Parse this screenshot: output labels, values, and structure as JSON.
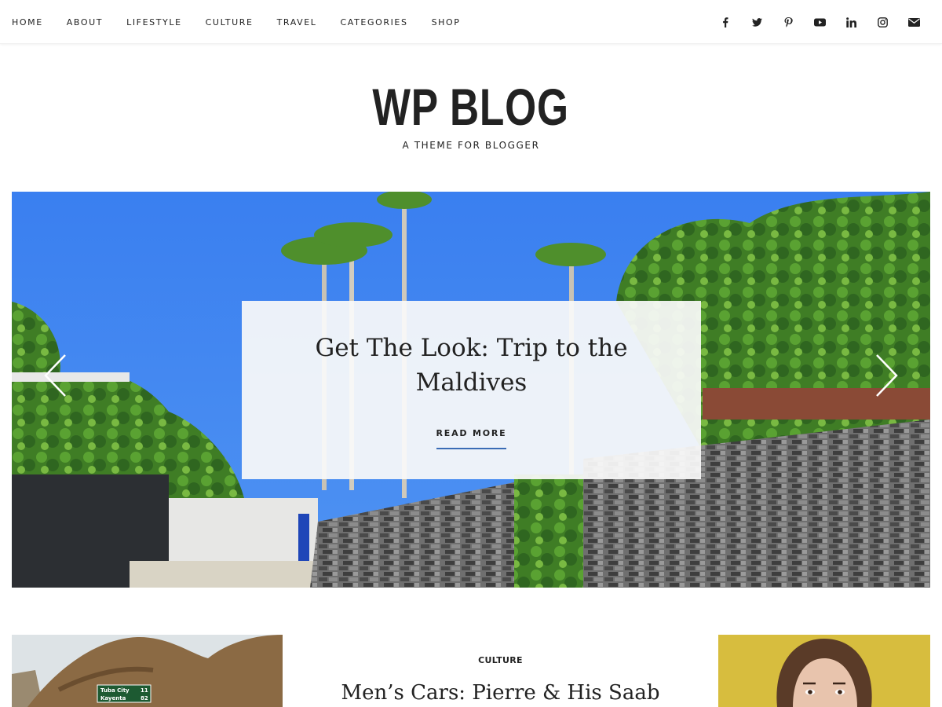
{
  "nav": {
    "items": [
      {
        "label": "HOME"
      },
      {
        "label": "ABOUT"
      },
      {
        "label": "LIFESTYLE"
      },
      {
        "label": "CULTURE"
      },
      {
        "label": "TRAVEL"
      },
      {
        "label": "CATEGORIES"
      },
      {
        "label": "SHOP"
      }
    ]
  },
  "social": {
    "icons": [
      "facebook-icon",
      "twitter-icon",
      "pinterest-icon",
      "youtube-icon",
      "linkedin-icon",
      "instagram-icon",
      "email-icon"
    ],
    "color": "#222222"
  },
  "branding": {
    "title": "WP BLOG",
    "tagline": "A THEME FOR BLOGGER"
  },
  "slider": {
    "slide_title": "Get The Look: Trip to the Maldives",
    "read_more_label": "READ MORE",
    "accent_color": "#3b6cb5",
    "prev_icon": "chevron-left-icon",
    "next_icon": "chevron-right-icon"
  },
  "posts": {
    "featured": {
      "category": "CULTURE",
      "title": "Men’s Cars: Pierre & His Saab"
    },
    "left_image_sign": {
      "line1_place": "Tuba City",
      "line1_miles": "11",
      "line2_place": "Kayenta",
      "line2_miles": "82"
    }
  }
}
